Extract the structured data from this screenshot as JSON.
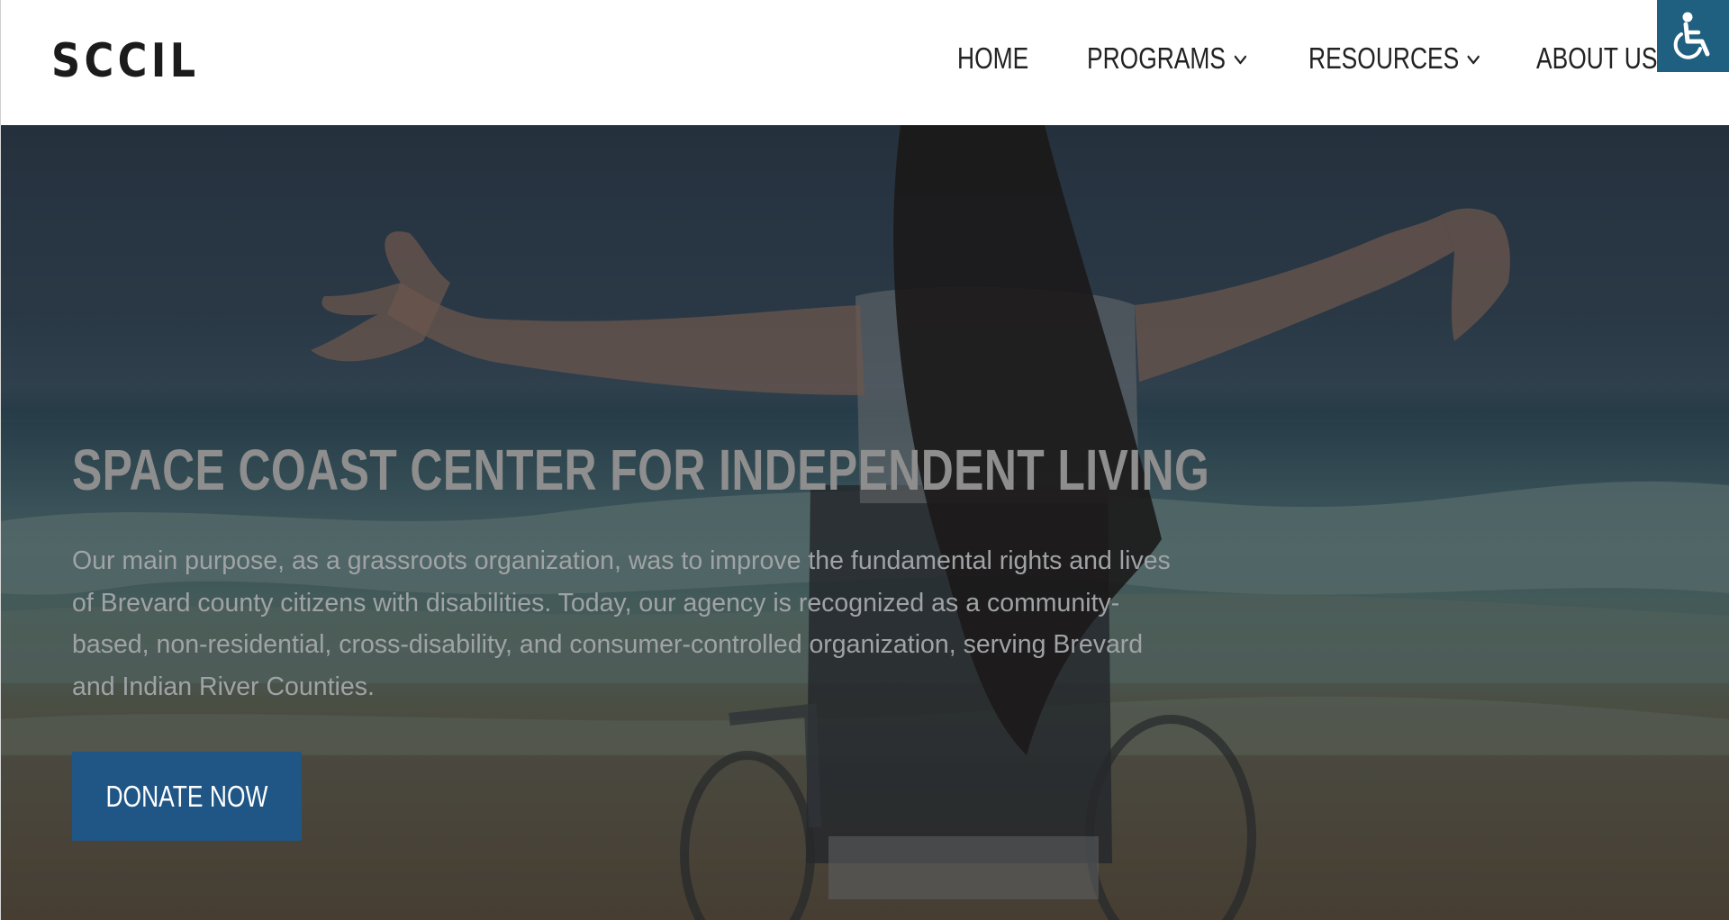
{
  "header": {
    "logo_text": "SCCIL",
    "nav": [
      {
        "label": "HOME",
        "has_dropdown": false
      },
      {
        "label": "PROGRAMS",
        "has_dropdown": true
      },
      {
        "label": "RESOURCES",
        "has_dropdown": true
      },
      {
        "label": "ABOUT US",
        "has_dropdown": false
      }
    ],
    "accessibility_icon": "wheelchair-icon"
  },
  "hero": {
    "title": "SPACE COAST CENTER FOR INDEPENDENT LIVING",
    "description": "Our main purpose, as a grassroots organization, was to improve the fundamental rights and lives of Brevard county citizens with disabilities. Today, our agency is recognized as a community-based, non-residential, cross-disability, and consumer-controlled organization, serving Brevard and Indian River Counties.",
    "donate_label": "DONATE NOW"
  },
  "colors": {
    "header_bg": "#ffffff",
    "nav_text": "#222222",
    "accessibility_button": "#1f5f7f",
    "donate_button": "#1f5686",
    "hero_title": "#8e8e8e",
    "hero_text": "#a0a3a5"
  }
}
